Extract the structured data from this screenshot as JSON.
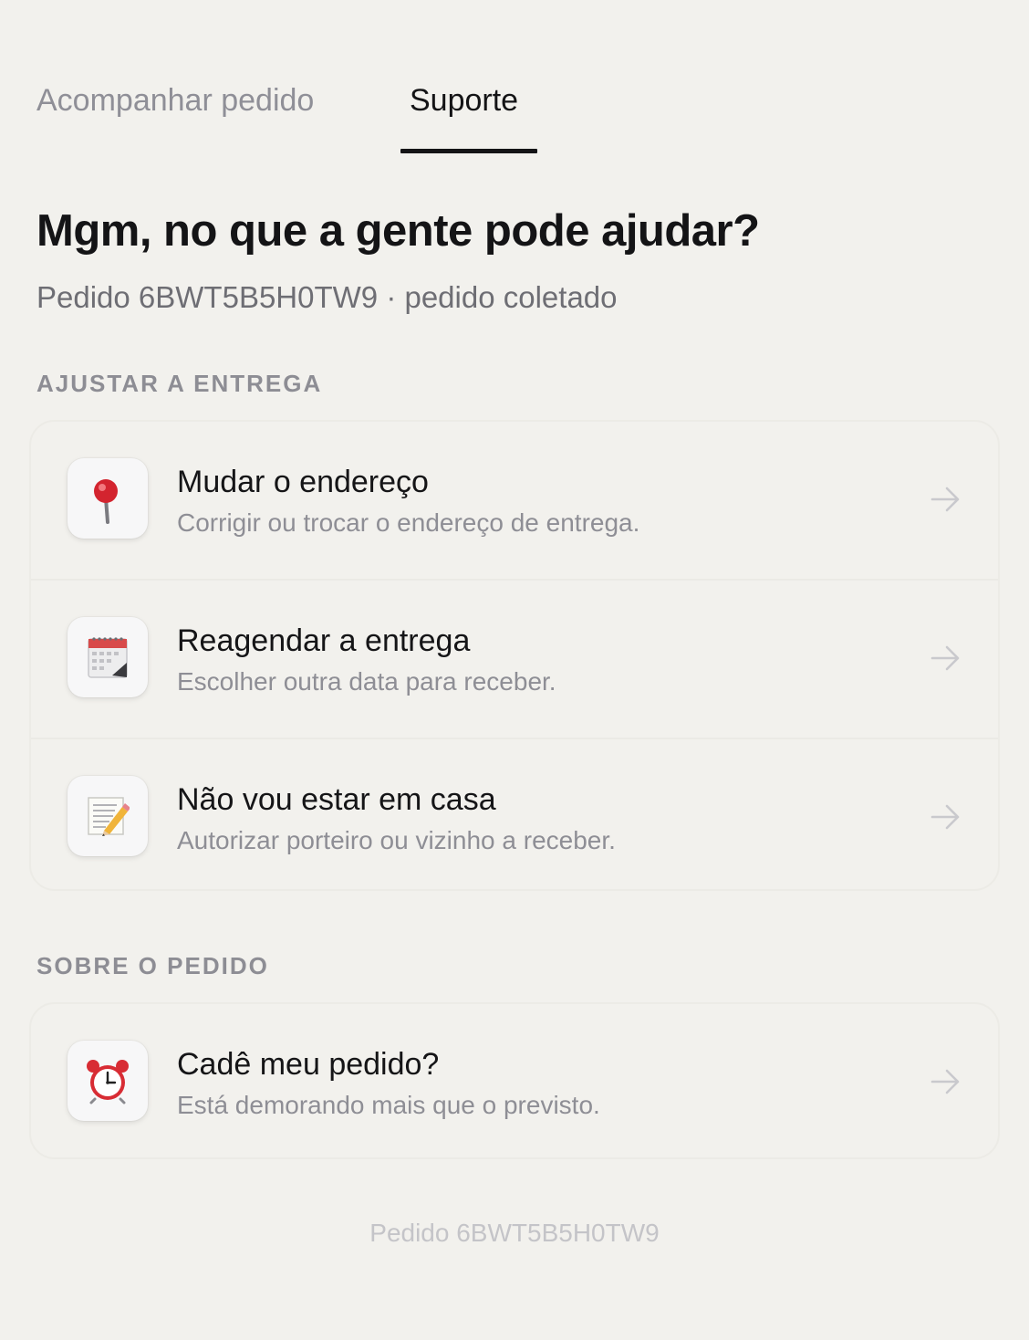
{
  "tabs": [
    {
      "label": "Acompanhar pedido",
      "active": false
    },
    {
      "label": "Suporte",
      "active": true
    }
  ],
  "header": {
    "title": "Mgm, no que a gente pode ajudar?",
    "subtitle": "Pedido 6BWT5B5H0TW9 · pedido coletado"
  },
  "sections": [
    {
      "label": "AJUSTAR A ENTREGA",
      "items": [
        {
          "icon": "pushpin-icon",
          "title": "Mudar o endereço",
          "description": "Corrigir ou trocar o endereço de entrega."
        },
        {
          "icon": "calendar-icon",
          "title": "Reagendar a entrega",
          "description": "Escolher outra data para receber."
        },
        {
          "icon": "memo-icon",
          "title": "Não vou estar em casa",
          "description": "Autorizar porteiro ou vizinho a receber."
        }
      ]
    },
    {
      "label": "SOBRE O PEDIDO",
      "items": [
        {
          "icon": "alarm-clock-icon",
          "title": "Cadê meu pedido?",
          "description": "Está demorando mais que o previsto."
        }
      ]
    }
  ],
  "footer": {
    "text": "Pedido 6BWT5B5H0TW9"
  },
  "colors": {
    "background": "#f2f1ed",
    "text_primary": "#141416",
    "text_secondary": "#8e8e95",
    "active_tab_indicator": "#141416",
    "arrow": "#c9c9cd"
  }
}
